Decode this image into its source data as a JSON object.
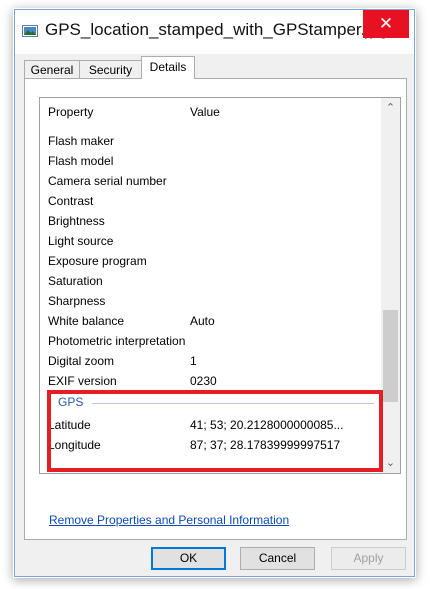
{
  "window": {
    "title": "GPS_location_stamped_with_GPStamper.jpg ...",
    "close_glyph": "✕"
  },
  "tabs": [
    {
      "label": "General",
      "active": false
    },
    {
      "label": "Security",
      "active": false
    },
    {
      "label": "Details",
      "active": true
    }
  ],
  "columns": {
    "property": "Property",
    "value": "Value"
  },
  "properties": [
    {
      "name": "Flash maker",
      "value": ""
    },
    {
      "name": "Flash model",
      "value": ""
    },
    {
      "name": "Camera serial number",
      "value": ""
    },
    {
      "name": "Contrast",
      "value": ""
    },
    {
      "name": "Brightness",
      "value": ""
    },
    {
      "name": "Light source",
      "value": ""
    },
    {
      "name": "Exposure program",
      "value": ""
    },
    {
      "name": "Saturation",
      "value": ""
    },
    {
      "name": "Sharpness",
      "value": ""
    },
    {
      "name": "White balance",
      "value": "Auto"
    },
    {
      "name": "Photometric interpretation",
      "value": ""
    },
    {
      "name": "Digital zoom",
      "value": "1"
    },
    {
      "name": "EXIF version",
      "value": "0230"
    }
  ],
  "gps_group": {
    "label": "GPS",
    "rows": [
      {
        "name": "Latitude",
        "value": "41; 53; 20.2128000000085..."
      },
      {
        "name": "Longitude",
        "value": "87; 37; 28.17839999997517"
      }
    ]
  },
  "scrollbar": {
    "up_glyph": "⌃",
    "down_glyph": "⌄"
  },
  "link": {
    "remove_properties": "Remove Properties and Personal Information"
  },
  "buttons": {
    "ok": "OK",
    "cancel": "Cancel",
    "apply": "Apply"
  },
  "colors": {
    "highlight": "#e31e24",
    "link": "#0b4ab8",
    "group": "#2a58b8",
    "close": "#e81123"
  }
}
